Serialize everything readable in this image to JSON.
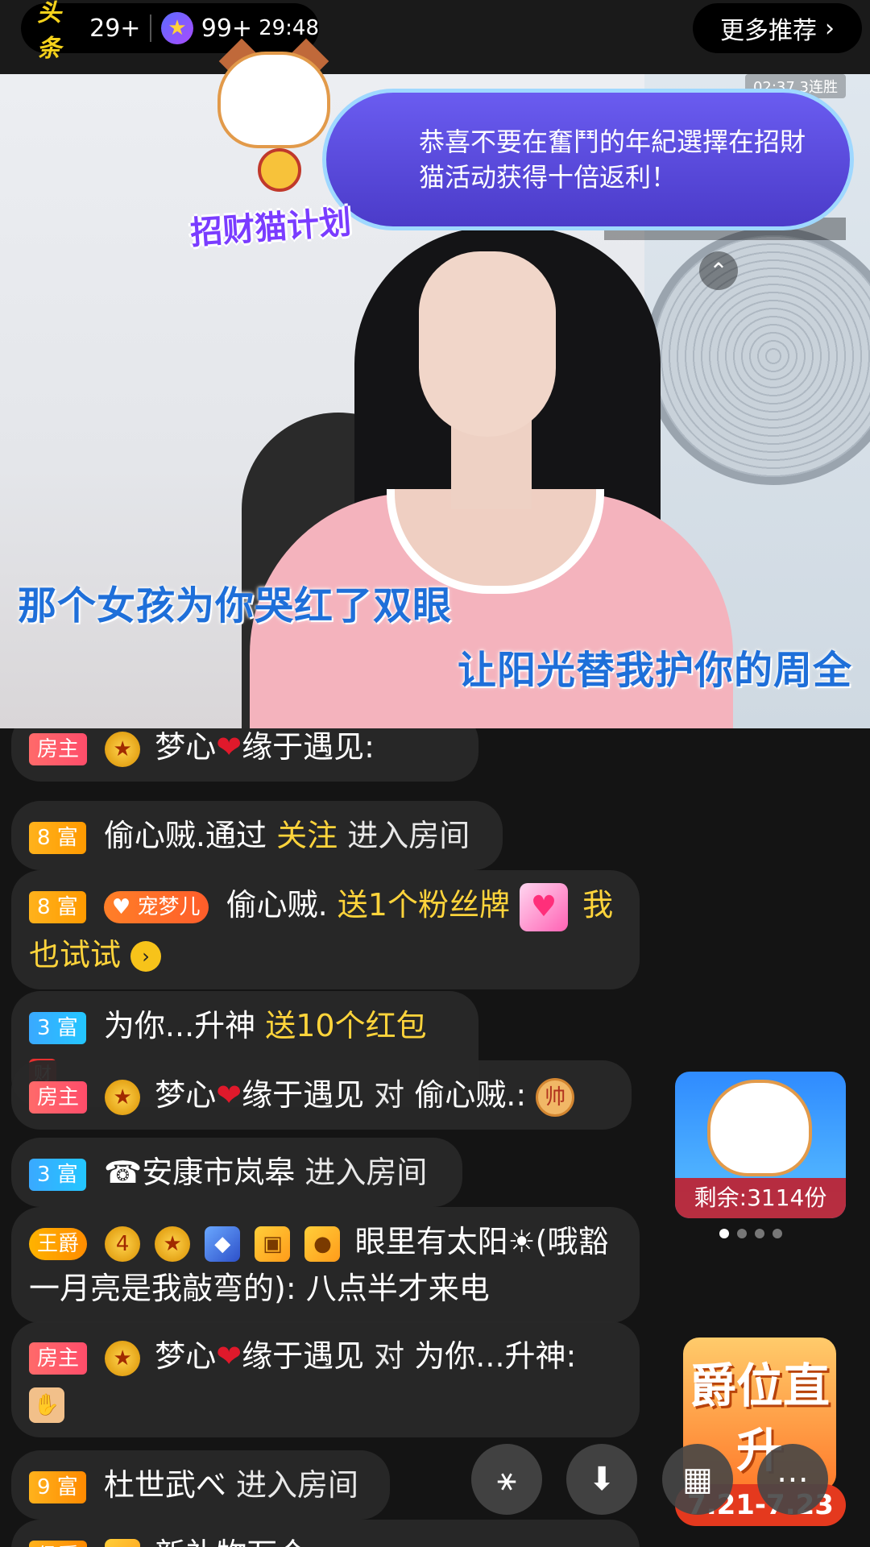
{
  "topbar": {
    "logo_text": "头条",
    "left_count": "29+",
    "star_count": "99+",
    "timer": "29:48",
    "more": "更多推荐",
    "chevron": "›"
  },
  "video": {
    "subtitle_1": "那个女孩为你哭红了双眼",
    "subtitle_2": "让阳光替我护你的周全",
    "overlay_label": "02:37 3连胜",
    "collapse": "⌃"
  },
  "promo": {
    "text": "恭喜不要在奮鬥的年紀選擇在招財猫活动获得十倍返利！",
    "title": "招财猫计划"
  },
  "chat": {
    "m0": {
      "badge": "房主",
      "name": "梦心",
      "heart": "❤",
      "name2": "缘于遇见:"
    },
    "m1": {
      "badge": "8 富",
      "name": "偷心贼.通过",
      "action": "关注",
      "tail": "进入房间"
    },
    "m2": {
      "badge": "8 富",
      "pet": "宠梦儿",
      "name": "偷心贼.",
      "action": "送1个粉丝牌",
      "tail": "我也试试"
    },
    "m3": {
      "badge": "3 富",
      "name": "为你...升神",
      "action": "送10个红包"
    },
    "m4": {
      "badge": "房主",
      "name": "梦心",
      "name2": "缘于遇见",
      "to": "对",
      "target": "偷心贼.:"
    },
    "m5": {
      "badge": "3 富",
      "name": "☎安康市岚皋",
      "tail": "进入房间"
    },
    "m6": {
      "badge": "王爵",
      "level": "4",
      "name": "眼里有太阳☀(哦豁一月亮是我敲弯的):",
      "text": "八点半才来电"
    },
    "m7": {
      "badge": "房主",
      "name": "梦心",
      "name2": "缘于遇见",
      "to": "对",
      "target": "为你...升神:"
    },
    "m8": {
      "badge": "9 富",
      "name": "杜世武べ",
      "tail": "进入房间"
    },
    "m9": {
      "badge": "侯爵",
      "text": "新礼物万众一"
    }
  },
  "widgets": {
    "lucky_remaining": "剩余:3114份",
    "rank_title": "爵位直升",
    "rank_date": "7.21-7.23"
  },
  "icons": {
    "chess": "帅",
    "red_packet": "财"
  }
}
